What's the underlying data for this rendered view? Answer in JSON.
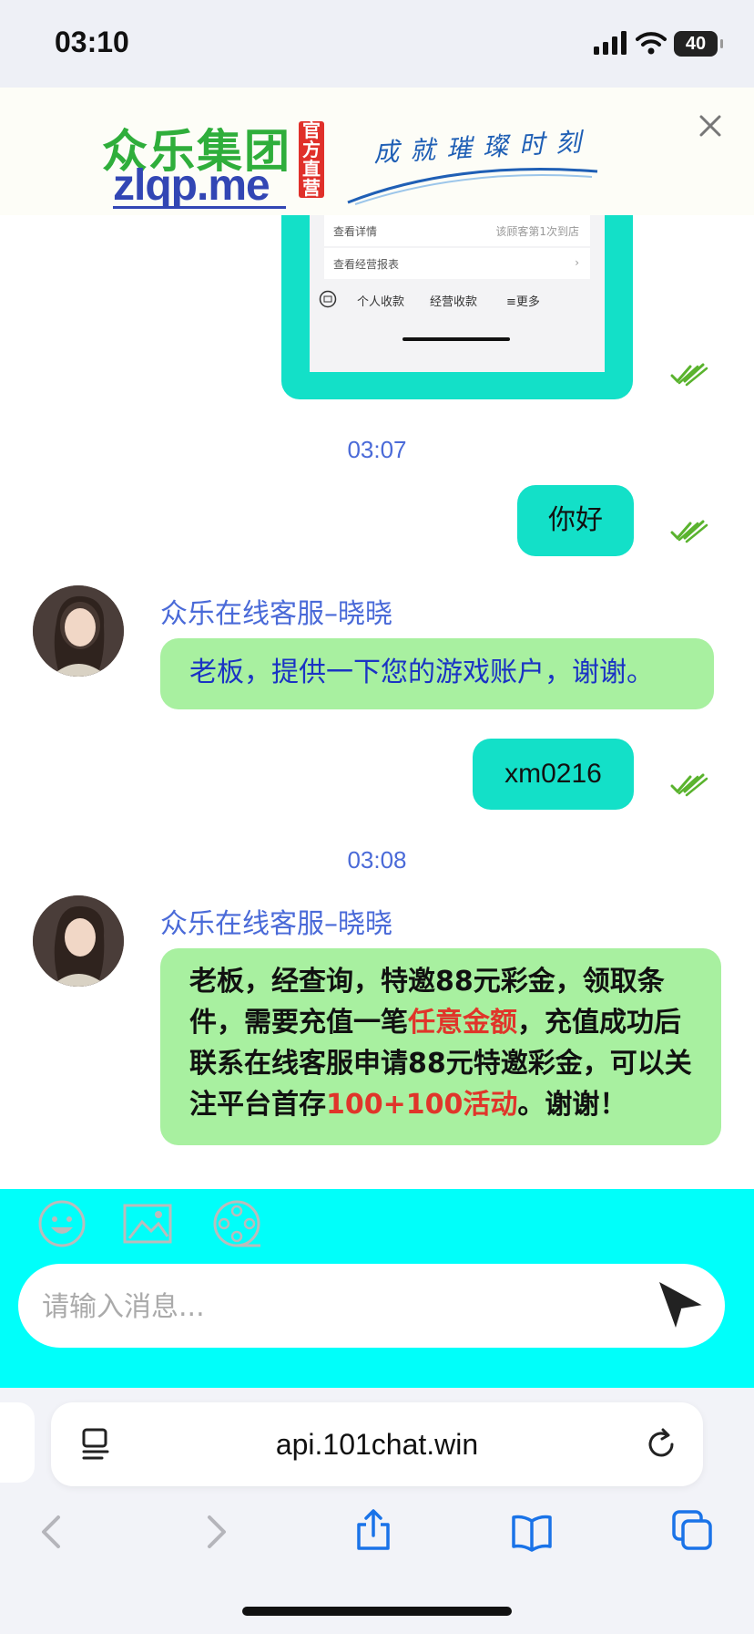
{
  "status_bar": {
    "time": "03:10",
    "battery": "40"
  },
  "banner": {
    "logo_cn": "众乐集团",
    "logo_url": "zlqp.me",
    "official_badge": "官方直营",
    "slogan": "成就璀璨时刻"
  },
  "screenshot_preview": {
    "row1_label": "查看详情",
    "row1_value": "该顾客第1次到店",
    "row2_label": "查看经营报表",
    "tab1": "个人收款",
    "tab2": "经营收款",
    "tab3": "≡更多"
  },
  "messages": {
    "time1": "03:07",
    "out1": "你好",
    "agent_name": "众乐在线客服–晓晓",
    "in1": "老板，提供一下您的游戏账户，谢谢。",
    "out2": "xm0216",
    "time2": "03:08",
    "in2_part1": "老板，经查询，特邀88元彩金，领取条件，需要充值一笔",
    "in2_red1": "任意金额",
    "in2_part2": "，充值成功后联系在线客服申请88元特邀彩金，可以关注平台首存",
    "in2_red2": "100+100活动",
    "in2_part3": "。谢谢！"
  },
  "composer": {
    "placeholder": "请输入消息..."
  },
  "browser": {
    "url": "api.101chat.win"
  },
  "colors": {
    "outgoing_bubble": "#13e0c8",
    "incoming_bubble": "#a8f0a0",
    "composer_bg": "#00fffa",
    "accent_blue": "#4a6ad8",
    "highlight_red": "#e0352a"
  }
}
